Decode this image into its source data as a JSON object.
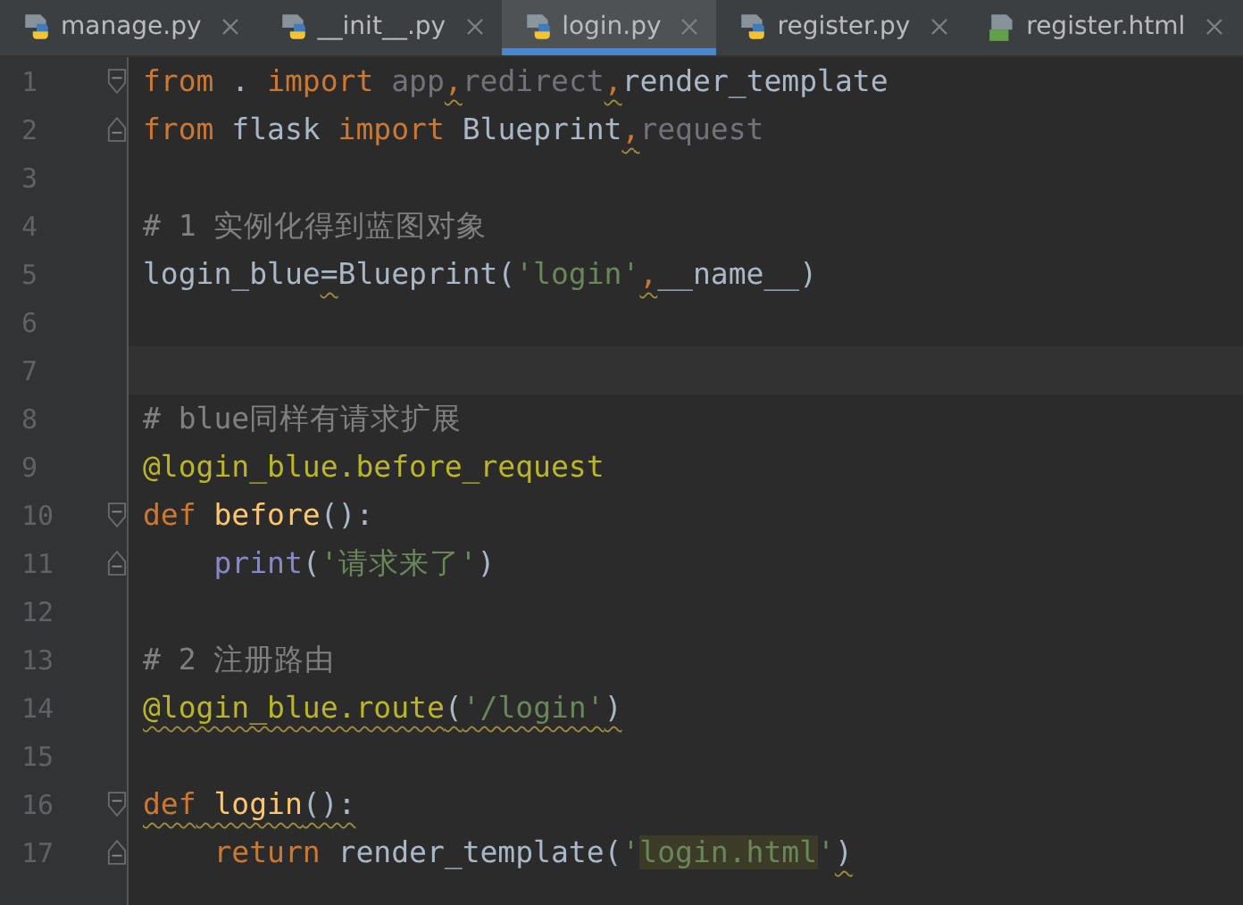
{
  "tabs": [
    {
      "label": "manage.py",
      "kind": "python",
      "selected": false
    },
    {
      "label": "__init__.py",
      "kind": "python",
      "selected": false
    },
    {
      "label": "login.py",
      "kind": "python",
      "selected": true
    },
    {
      "label": "register.py",
      "kind": "python",
      "selected": false
    },
    {
      "label": "register.html",
      "kind": "html",
      "selected": false
    }
  ],
  "lines": [
    {
      "number": "1",
      "fold_start": true,
      "tokens": [
        {
          "text": "from",
          "kind": "kw"
        },
        {
          "text": " . ",
          "kind": "plain"
        },
        {
          "text": "import",
          "kind": "kw"
        },
        {
          "text": " app",
          "kind": "unused"
        },
        {
          "text": ",",
          "kind": "comma",
          "warning": true
        },
        {
          "text": "redirect",
          "kind": "unused"
        },
        {
          "text": ",",
          "kind": "comma",
          "warning": true
        },
        {
          "text": "render_template",
          "kind": "plain"
        }
      ]
    },
    {
      "number": "2",
      "fold_end": true,
      "tokens": [
        {
          "text": "from",
          "kind": "kw"
        },
        {
          "text": " flask ",
          "kind": "plain"
        },
        {
          "text": "import",
          "kind": "kw"
        },
        {
          "text": " Blueprint",
          "kind": "plain"
        },
        {
          "text": ",",
          "kind": "comma",
          "warning": true
        },
        {
          "text": "request",
          "kind": "unused"
        }
      ]
    },
    {
      "number": "3"
    },
    {
      "number": "4",
      "tokens": [
        {
          "text": "# 1 实例化得到蓝图对象",
          "kind": "comment"
        }
      ]
    },
    {
      "number": "5",
      "tokens": [
        {
          "text": "login_blue",
          "kind": "plain"
        },
        {
          "text": "=",
          "kind": "plain",
          "warning": true
        },
        {
          "text": "Blueprint(",
          "kind": "plain"
        },
        {
          "text": "'login'",
          "kind": "str"
        },
        {
          "text": ",",
          "kind": "comma",
          "warning": true
        },
        {
          "text": "__name__)",
          "kind": "plain"
        }
      ]
    },
    {
      "number": "6"
    },
    {
      "number": "7",
      "current": true
    },
    {
      "number": "8",
      "tokens": [
        {
          "text": "# blue同样有请求扩展",
          "kind": "comment"
        }
      ]
    },
    {
      "number": "9",
      "tokens": [
        {
          "text": "@login_blue.before_request",
          "kind": "deco"
        }
      ]
    },
    {
      "number": "10",
      "fold_start": true,
      "tokens": [
        {
          "text": "def",
          "kind": "kw"
        },
        {
          "text": " before",
          "kind": "fn"
        },
        {
          "text": "():",
          "kind": "plain"
        }
      ]
    },
    {
      "number": "11",
      "fold_end": true,
      "tokens": [
        {
          "text": "    print",
          "kind": "builtin"
        },
        {
          "text": "(",
          "kind": "plain"
        },
        {
          "text": "'请求来了'",
          "kind": "str"
        },
        {
          "text": ")",
          "kind": "plain"
        }
      ]
    },
    {
      "number": "12"
    },
    {
      "number": "13",
      "tokens": [
        {
          "text": "# 2 注册路由",
          "kind": "comment"
        }
      ]
    },
    {
      "number": "14",
      "tokens": [
        {
          "text": "@login_blue.route",
          "kind": "deco",
          "warning": true
        },
        {
          "text": "(",
          "kind": "plain",
          "warning": true
        },
        {
          "text": "'/login'",
          "kind": "str",
          "warning": true
        },
        {
          "text": ")",
          "kind": "plain",
          "warning": true
        }
      ]
    },
    {
      "number": "15"
    },
    {
      "number": "16",
      "fold_start": true,
      "tokens": [
        {
          "text": "def",
          "kind": "kw",
          "warning": true
        },
        {
          "text": " login",
          "kind": "fn",
          "warning": true
        },
        {
          "text": "():",
          "kind": "plain",
          "warning": true
        }
      ]
    },
    {
      "number": "17",
      "fold_end": true,
      "tokens": [
        {
          "text": "    return",
          "kind": "kw"
        },
        {
          "text": " render_template(",
          "kind": "plain"
        },
        {
          "text": "'",
          "kind": "str"
        },
        {
          "text": "login.html",
          "kind": "str",
          "highlight": true
        },
        {
          "text": "'",
          "kind": "str"
        },
        {
          "text": ")",
          "kind": "plain",
          "warning": true
        }
      ]
    }
  ]
}
